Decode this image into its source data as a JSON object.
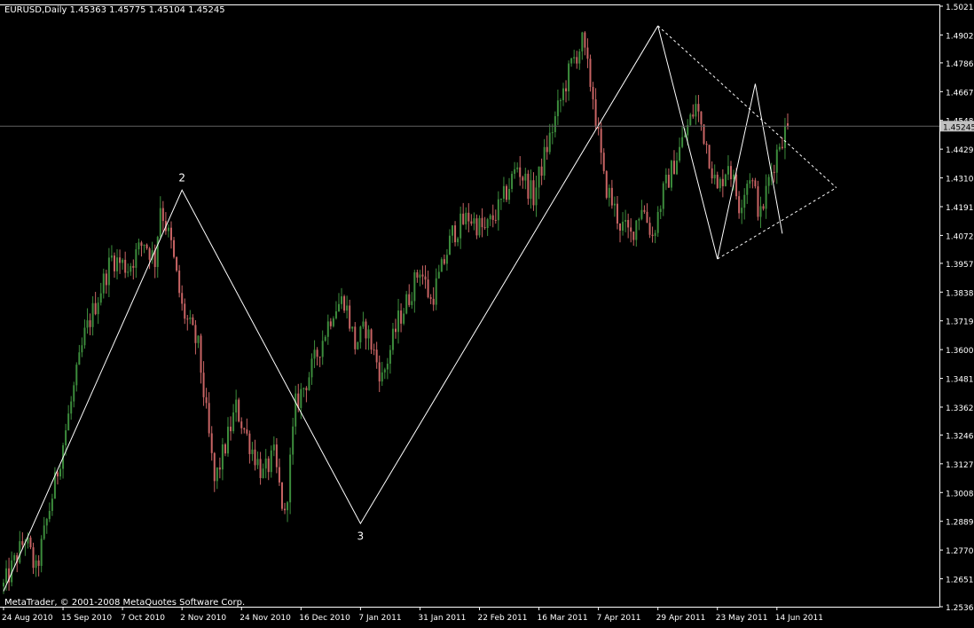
{
  "window": {
    "header": "EURUSD,Daily  1.45363 1.45775 1.45104 1.45245",
    "copyright": "MetaTrader, © 2001-2008 MetaQuotes Software Corp."
  },
  "colors": {
    "background": "#000000",
    "bull": "#3c8c3c",
    "bear": "#c86464",
    "axis": "#ffffff",
    "pattern_line": "#ffffff",
    "price_tag_bg": "#c0c0c0"
  },
  "chart_data": {
    "type": "candlestick",
    "symbol": "EURUSD",
    "timeframe": "Daily",
    "ylim": [
      1.2536,
      1.5021
    ],
    "y_ticks": [
      "1.50210",
      "1.49020",
      "1.47865",
      "1.46675",
      "1.45485",
      "1.44295",
      "1.43105",
      "1.41915",
      "1.40725",
      "1.39570",
      "1.38380",
      "1.37190",
      "1.36000",
      "1.34810",
      "1.33620",
      "1.32465",
      "1.31275",
      "1.30085",
      "1.28895",
      "1.27705",
      "1.26515",
      "1.25360"
    ],
    "x_ticks": [
      "24 Aug 2010",
      "15 Sep 2010",
      "7 Oct 2010",
      "2 Nov 2010",
      "24 Nov 2010",
      "16 Dec 2010",
      "7 Jan 2011",
      "31 Jan 2011",
      "22 Feb 2011",
      "16 Mar 2011",
      "7 Apr 2011",
      "29 Apr 2011",
      "23 May 2011",
      "14 Jun 2011"
    ],
    "current_price": "1.45245",
    "last_bar": {
      "open": 1.45363,
      "high": 1.45775,
      "low": 1.45104,
      "close": 1.45245
    },
    "swing_points": [
      {
        "date": "24 Aug 2010",
        "price": 1.26
      },
      {
        "date": "2 Nov 2010",
        "price": 1.426,
        "label": "2"
      },
      {
        "date": "7 Jan 2011",
        "price": 1.288,
        "label": "3"
      },
      {
        "date": "29 Apr 2011",
        "price": 1.494
      }
    ],
    "triangle_upper": [
      {
        "date": "29 Apr 2011",
        "price": 1.494
      },
      {
        "date": "6 Jul 2011",
        "price": 1.427
      }
    ],
    "triangle_lower": [
      {
        "date": "23 May 2011",
        "price": 1.3975
      },
      {
        "date": "6 Jul 2011",
        "price": 1.427
      }
    ],
    "inner_zigzag": [
      {
        "date": "29 Apr 2011",
        "price": 1.494
      },
      {
        "date": "23 May 2011",
        "price": 1.3975
      },
      {
        "date": "6 Jun 2011",
        "price": 1.47
      },
      {
        "date": "16 Jun 2011",
        "price": 1.408
      }
    ],
    "waypoints": [
      [
        0,
        1.262
      ],
      [
        8,
        1.282
      ],
      [
        12,
        1.268
      ],
      [
        20,
        1.31
      ],
      [
        30,
        1.366
      ],
      [
        40,
        1.398
      ],
      [
        46,
        1.394
      ],
      [
        52,
        1.405
      ],
      [
        56,
        1.397
      ],
      [
        58,
        1.42
      ],
      [
        62,
        1.403
      ],
      [
        66,
        1.377
      ],
      [
        72,
        1.361
      ],
      [
        78,
        1.305
      ],
      [
        82,
        1.32
      ],
      [
        86,
        1.336
      ],
      [
        90,
        1.324
      ],
      [
        96,
        1.308
      ],
      [
        100,
        1.316
      ],
      [
        104,
        1.29
      ],
      [
        108,
        1.337
      ],
      [
        114,
        1.352
      ],
      [
        122,
        1.377
      ],
      [
        126,
        1.381
      ],
      [
        130,
        1.362
      ],
      [
        134,
        1.369
      ],
      [
        140,
        1.348
      ],
      [
        146,
        1.372
      ],
      [
        150,
        1.382
      ],
      [
        154,
        1.394
      ],
      [
        158,
        1.38
      ],
      [
        162,
        1.393
      ],
      [
        166,
        1.408
      ],
      [
        172,
        1.415
      ],
      [
        178,
        1.409
      ],
      [
        184,
        1.42
      ],
      [
        190,
        1.436
      ],
      [
        196,
        1.423
      ],
      [
        200,
        1.44
      ],
      [
        206,
        1.463
      ],
      [
        210,
        1.478
      ],
      [
        214,
        1.487
      ],
      [
        218,
        1.465
      ],
      [
        222,
        1.43
      ],
      [
        228,
        1.412
      ],
      [
        232,
        1.407
      ],
      [
        236,
        1.42
      ],
      [
        240,
        1.407
      ],
      [
        244,
        1.425
      ],
      [
        250,
        1.443
      ],
      [
        256,
        1.461
      ],
      [
        260,
        1.445
      ],
      [
        264,
        1.425
      ],
      [
        268,
        1.438
      ],
      [
        272,
        1.42
      ],
      [
        276,
        1.433
      ],
      [
        280,
        1.415
      ],
      [
        283,
        1.43
      ],
      [
        287,
        1.446
      ],
      [
        290,
        1.452
      ]
    ],
    "n_bars": 291,
    "pattern_labels": [
      "2",
      "3"
    ]
  }
}
